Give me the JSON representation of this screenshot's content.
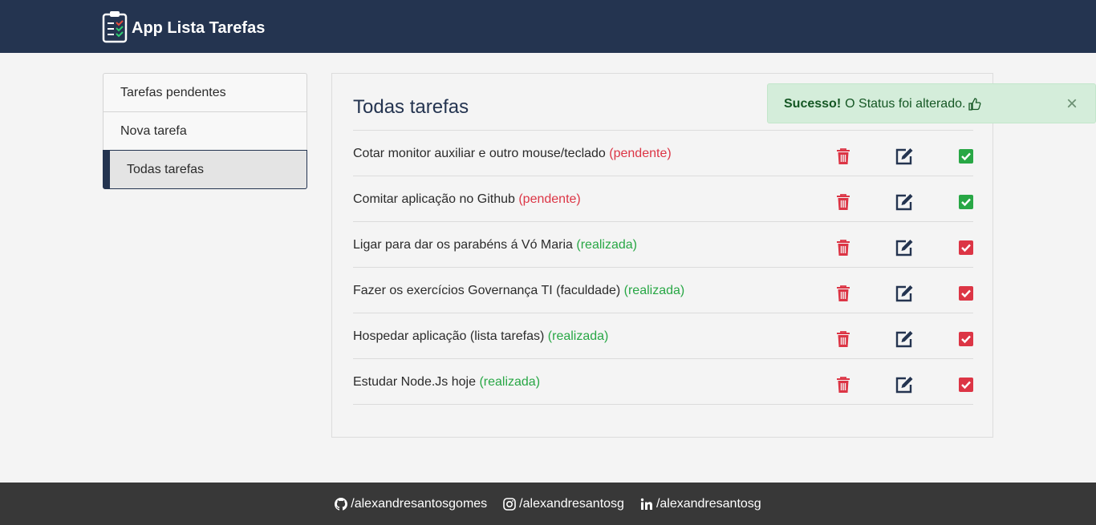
{
  "app": {
    "title": "App Lista Tarefas",
    "logo_icon": "clipboard-checklist-icon"
  },
  "sidebar": {
    "items": [
      {
        "label": "Tarefas pendentes",
        "active": false
      },
      {
        "label": "Nova tarefa",
        "active": false
      },
      {
        "label": "Todas tarefas",
        "active": true
      }
    ]
  },
  "main": {
    "title": "Todas tarefas",
    "tasks": [
      {
        "text": "Cotar monitor auxiliar e outro mouse/teclado",
        "status": "(pendente)"
      },
      {
        "text": "Comitar aplicação no Github",
        "status": "(pendente)"
      },
      {
        "text": "Ligar para dar os parabéns á Vó Maria",
        "status": "(realizada)"
      },
      {
        "text": "Fazer os exercícios Governança TI (faculdade)",
        "status": "(realizada)"
      },
      {
        "text": "Hospedar aplicação (lista tarefas)",
        "status": "(realizada)"
      },
      {
        "text": "Estudar Node.Js hoje",
        "status": "(realizada)"
      }
    ],
    "icons": {
      "delete": "trash-icon",
      "edit": "edit-icon",
      "check": "check-square-icon"
    }
  },
  "alert": {
    "strong": "Sucesso!",
    "message": "O Status foi alterado.",
    "icon": "thumbs-up-icon",
    "close": "×"
  },
  "footer": {
    "links": [
      {
        "icon": "github-icon",
        "label": "/alexandresantosgomes"
      },
      {
        "icon": "instagram-icon",
        "label": "/alexandresantosg"
      },
      {
        "icon": "linkedin-icon",
        "label": "/alexandresantosg"
      }
    ]
  },
  "colors": {
    "navbar": "#243450",
    "pendente": "#dc3545",
    "realizada": "#28a745",
    "footer": "#383838",
    "alert_bg": "#d4edda"
  }
}
